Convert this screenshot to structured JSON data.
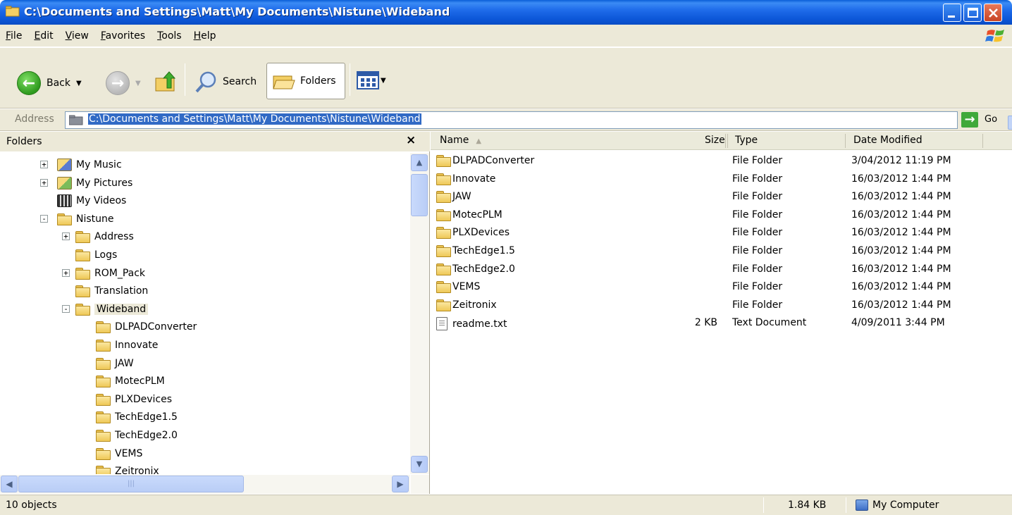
{
  "window": {
    "title": "C:\\Documents and Settings\\Matt\\My Documents\\Nistune\\Wideband"
  },
  "menu": [
    "File",
    "Edit",
    "View",
    "Favorites",
    "Tools",
    "Help"
  ],
  "toolbar": {
    "back_label": "Back",
    "search_label": "Search",
    "folders_label": "Folders"
  },
  "address": {
    "label": "Address",
    "value": "C:\\Documents and Settings\\Matt\\My Documents\\Nistune\\Wideband",
    "go_label": "Go"
  },
  "folders_pane": {
    "title": "Folders",
    "close_glyph": "×",
    "tree": [
      {
        "label": "My Music",
        "level": 0,
        "expander": "+",
        "icon": "music-folder-icon"
      },
      {
        "label": "My Pictures",
        "level": 0,
        "expander": "+",
        "icon": "pictures-folder-icon"
      },
      {
        "label": "My Videos",
        "level": 0,
        "expander": "",
        "icon": "videos-folder-icon"
      },
      {
        "label": "Nistune",
        "level": 0,
        "expander": "−",
        "icon": "folder-icon"
      },
      {
        "label": "Address",
        "level": 1,
        "expander": "+",
        "icon": "folder-icon"
      },
      {
        "label": "Logs",
        "level": 1,
        "expander": "",
        "icon": "folder-icon"
      },
      {
        "label": "ROM_Pack",
        "level": 1,
        "expander": "+",
        "icon": "folder-icon"
      },
      {
        "label": "Translation",
        "level": 1,
        "expander": "",
        "icon": "folder-icon"
      },
      {
        "label": "Wideband",
        "level": 1,
        "expander": "−",
        "icon": "folder-open-icon",
        "selected": true
      },
      {
        "label": "DLPADConverter",
        "level": 2,
        "expander": "",
        "icon": "folder-icon"
      },
      {
        "label": "Innovate",
        "level": 2,
        "expander": "",
        "icon": "folder-icon"
      },
      {
        "label": "JAW",
        "level": 2,
        "expander": "",
        "icon": "folder-icon"
      },
      {
        "label": "MotecPLM",
        "level": 2,
        "expander": "",
        "icon": "folder-icon"
      },
      {
        "label": "PLXDevices",
        "level": 2,
        "expander": "",
        "icon": "folder-icon"
      },
      {
        "label": "TechEdge1.5",
        "level": 2,
        "expander": "",
        "icon": "folder-icon"
      },
      {
        "label": "TechEdge2.0",
        "level": 2,
        "expander": "",
        "icon": "folder-icon"
      },
      {
        "label": "VEMS",
        "level": 2,
        "expander": "",
        "icon": "folder-icon"
      },
      {
        "label": "Zeitronix",
        "level": 2,
        "expander": "",
        "icon": "folder-icon"
      }
    ]
  },
  "file_list": {
    "columns": [
      "Name",
      "Size",
      "Type",
      "Date Modified"
    ],
    "rows": [
      {
        "name": "DLPADConverter",
        "size": "",
        "type": "File Folder",
        "modified": "3/04/2012 11:19 PM",
        "icon": "folder-icon"
      },
      {
        "name": "Innovate",
        "size": "",
        "type": "File Folder",
        "modified": "16/03/2012 1:44 PM",
        "icon": "folder-icon"
      },
      {
        "name": "JAW",
        "size": "",
        "type": "File Folder",
        "modified": "16/03/2012 1:44 PM",
        "icon": "folder-icon"
      },
      {
        "name": "MotecPLM",
        "size": "",
        "type": "File Folder",
        "modified": "16/03/2012 1:44 PM",
        "icon": "folder-icon"
      },
      {
        "name": "PLXDevices",
        "size": "",
        "type": "File Folder",
        "modified": "16/03/2012 1:44 PM",
        "icon": "folder-icon"
      },
      {
        "name": "TechEdge1.5",
        "size": "",
        "type": "File Folder",
        "modified": "16/03/2012 1:44 PM",
        "icon": "folder-icon"
      },
      {
        "name": "TechEdge2.0",
        "size": "",
        "type": "File Folder",
        "modified": "16/03/2012 1:44 PM",
        "icon": "folder-icon"
      },
      {
        "name": "VEMS",
        "size": "",
        "type": "File Folder",
        "modified": "16/03/2012 1:44 PM",
        "icon": "folder-icon"
      },
      {
        "name": "Zeitronix",
        "size": "",
        "type": "File Folder",
        "modified": "16/03/2012 1:44 PM",
        "icon": "folder-icon"
      },
      {
        "name": "readme.txt",
        "size": "2 KB",
        "type": "Text Document",
        "modified": "4/09/2011 3:44 PM",
        "icon": "text-file-icon"
      }
    ]
  },
  "status": {
    "objects": "10 objects",
    "size": "1.84 KB",
    "zone": "My Computer"
  },
  "colors": {
    "titlebar": "#0b55d6",
    "chrome": "#ece9d8",
    "selection": "#316ac5"
  }
}
